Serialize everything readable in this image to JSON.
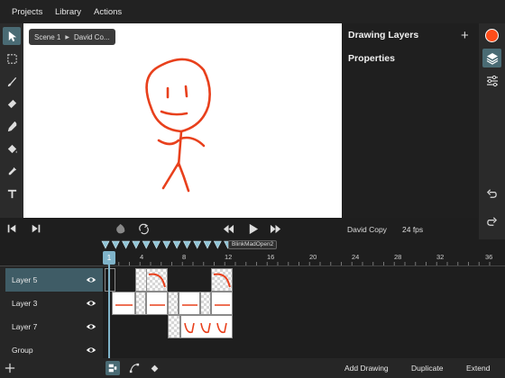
{
  "menu": {
    "projects": "Projects",
    "library": "Library",
    "actions": "Actions"
  },
  "canvas": {
    "breadcrumb_scene": "Scene 1",
    "breadcrumb_drawing": "David Co..."
  },
  "panel": {
    "drawing_layers": "Drawing Layers",
    "properties": "Properties"
  },
  "colors": {
    "accent": "#4a6b74",
    "current_color": "#ff4d1a",
    "playhead": "#7fb3c9",
    "stroke": "#e8401c"
  },
  "transport": {
    "drawing_name": "David Copy",
    "fps": "24 fps"
  },
  "timeline": {
    "marker_label": "BlinkMadOpen2",
    "current_frame": "1",
    "ruler": [
      "4",
      "8",
      "12",
      "16",
      "20",
      "24",
      "28",
      "32",
      "36"
    ],
    "layers": [
      "Layer 5",
      "Layer 3",
      "Layer 7",
      "Group"
    ]
  },
  "bottom": {
    "add_drawing": "Add Drawing",
    "duplicate": "Duplicate",
    "extend": "Extend"
  },
  "icons": [
    "select-arrow-icon",
    "marquee-icon",
    "brush-icon",
    "eraser-icon",
    "pencil-icon",
    "paint-bucket-icon",
    "eyedropper-icon",
    "text-icon",
    "layers-icon",
    "sliders-icon",
    "undo-icon",
    "redo-icon",
    "prev-frame-icon",
    "next-frame-icon",
    "onion-skin-icon",
    "loop-icon",
    "rewind-icon",
    "play-icon",
    "fast-forward-icon",
    "eye-icon",
    "plus-icon"
  ]
}
